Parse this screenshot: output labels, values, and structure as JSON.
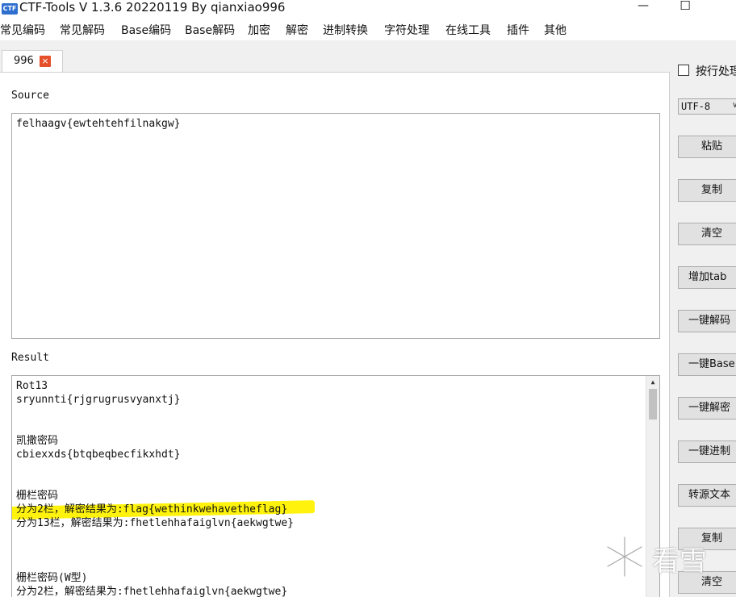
{
  "window": {
    "title": "CTF-Tools V 1.3.6 20220119 By qianxiao996",
    "icon_label": "CTF",
    "minimize_glyph": "—",
    "maximize_glyph": "☐"
  },
  "menu": [
    "常见编码",
    "常见解码",
    "Base编码",
    "Base解码",
    "加密",
    "解密",
    "进制转换",
    "字符处理",
    "在线工具",
    "插件",
    "其他"
  ],
  "tabs": [
    {
      "label": "996",
      "close_glyph": "×"
    }
  ],
  "source": {
    "label": "Source",
    "text": "felhaagv{ewtehtehfilnakgw}"
  },
  "result": {
    "label": "Result",
    "lines": [
      "Rot13",
      "sryunnti{rjgrugrusvyanxtj}",
      "",
      "",
      "凯撒密码",
      "cbiexxds{btqbeqbecfikxhdt}",
      "",
      "",
      "栅栏密码",
      "分为2栏，解密结果为:flag{wethinkwehavetheflag}",
      "分为13栏，解密结果为:fhetlehhafaiglvn{aekwgtwe}",
      "",
      "",
      "",
      "栅栏密码(W型)",
      "分为2栏，解密结果为:fhetlehhafaiglvn{aekwgtwe}"
    ],
    "highlighted_line_index": 9,
    "highlight_color": "#fff200",
    "scroll_up_glyph": "▲"
  },
  "right_panel": {
    "checkbox_label": "按行处理",
    "checkbox_checked": false,
    "encoding": "UTF-8",
    "encoding_arrow": "∨",
    "buttons": [
      "粘贴",
      "复制",
      "清空",
      "增加tab",
      "一键解码",
      "一键Base",
      "一键解密",
      "一键进制",
      "转源文本",
      "复制",
      "清空"
    ]
  },
  "watermark": {
    "text": "看雪"
  }
}
